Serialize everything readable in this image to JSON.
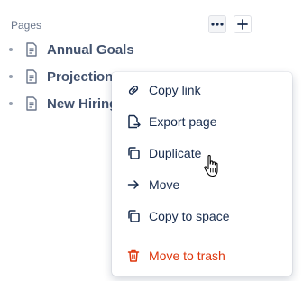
{
  "sidebar": {
    "section_label": "Pages",
    "more_button": "•••",
    "add_button": "+",
    "pages": [
      {
        "title": "Annual Goals"
      },
      {
        "title": "Projections"
      },
      {
        "title": "New Hiring"
      }
    ]
  },
  "context_menu": {
    "items": [
      {
        "label": "Copy link",
        "icon": "link-icon"
      },
      {
        "label": "Export page",
        "icon": "export-page-icon"
      },
      {
        "label": "Duplicate",
        "icon": "duplicate-icon"
      },
      {
        "label": "Move",
        "icon": "arrow-right-icon"
      },
      {
        "label": "Copy to space",
        "icon": "copy-to-space-icon"
      },
      {
        "label": "Move to trash",
        "icon": "trash-icon"
      }
    ]
  },
  "colors": {
    "danger": "#de350b",
    "text": "#172b4d",
    "muted": "#6b778c"
  }
}
